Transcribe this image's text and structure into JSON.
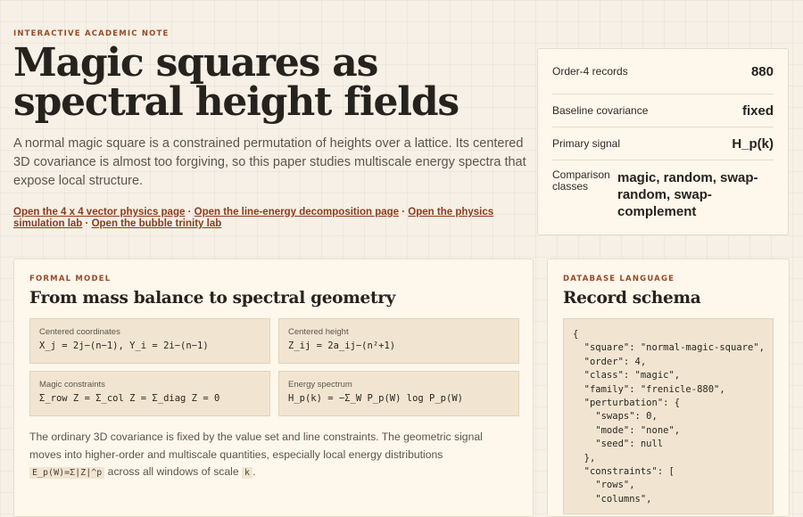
{
  "hero": {
    "eyebrow": "INTERACTIVE ACADEMIC NOTE",
    "title_line1": "Magic squares as",
    "title_line2": "spectral height fields",
    "lede": "A normal magic square is a constrained permutation of heights over a lattice. Its centered 3D covariance is almost too forgiving, so this paper studies multiscale energy spectra that expose local structure.",
    "links": [
      "Open the 4 x 4 vector physics page",
      "Open the line-energy decomposition page",
      "Open the physics simulation lab",
      "Open the bubble trinity lab"
    ],
    "separator": "·"
  },
  "stats": [
    {
      "label": "Order-4 records",
      "value": "880"
    },
    {
      "label": "Baseline covariance",
      "value": "fixed"
    },
    {
      "label": "Primary signal",
      "value": "H_p(k)"
    },
    {
      "label": "Comparison classes",
      "value": "magic, random, swap-random, swap-complement"
    }
  ],
  "model": {
    "eyebrow": "FORMAL MODEL",
    "title": "From mass balance to spectral geometry",
    "cells": [
      {
        "label": "Centered coordinates",
        "formula": "X_j = 2j−(n−1), Y_i = 2i−(n−1)"
      },
      {
        "label": "Centered height",
        "formula": "Z_ij = 2a_ij−(n²+1)"
      },
      {
        "label": "Magic constraints",
        "formula": "Σ_row Z = Σ_col Z = Σ_diag Z = 0"
      },
      {
        "label": "Energy spectrum",
        "formula": "H_p(k) = −Σ_W P_p(W) log P_p(W)"
      }
    ],
    "body_before": "The ordinary 3D covariance is fixed by the value set and line constraints. The geometric signal moves into higher-order and multiscale quantities, especially local energy distributions ",
    "code1": "E_p(W)=Σ|Z|^p",
    "body_middle": " across all windows of scale ",
    "code2": "k",
    "body_after": "."
  },
  "schema": {
    "eyebrow": "DATABASE LANGUAGE",
    "title": "Record schema",
    "code": "{\n  \"square\": \"normal-magic-square\",\n  \"order\": 4,\n  \"class\": \"magic\",\n  \"family\": \"frenicle-880\",\n  \"perturbation\": {\n    \"swaps\": 0,\n    \"mode\": \"none\",\n    \"seed\": null\n  },\n  \"constraints\": [\n    \"rows\",\n    \"columns\","
  }
}
